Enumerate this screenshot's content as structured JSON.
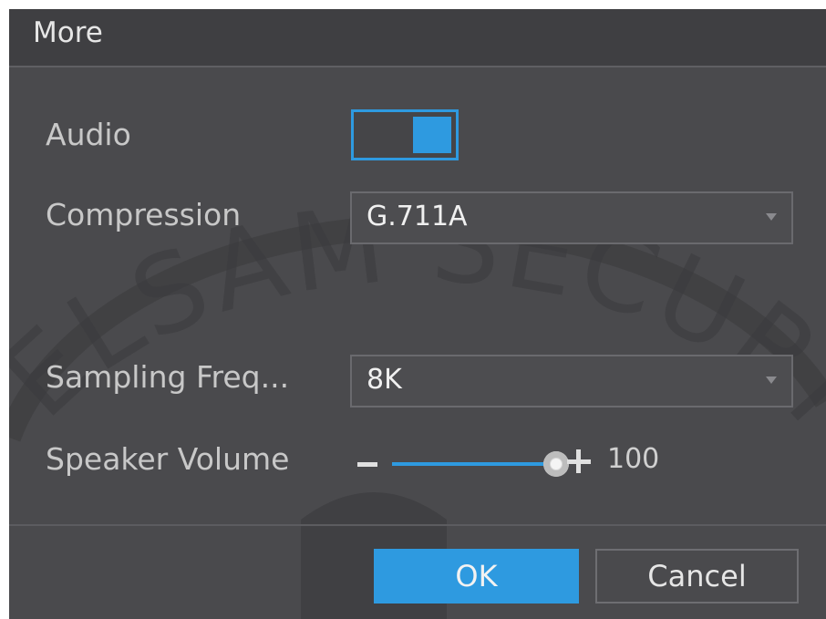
{
  "dialog": {
    "title": "More"
  },
  "form": {
    "audio": {
      "label": "Audio",
      "enabled": true
    },
    "compression": {
      "label": "Compression",
      "value": "G.711A"
    },
    "sampling": {
      "label": "Sampling Freq...",
      "value": "8K"
    },
    "speaker_volume": {
      "label": "Speaker Volume",
      "value": "100",
      "level_percent": 100
    }
  },
  "buttons": {
    "ok_label": "OK",
    "cancel_label": "Cancel"
  },
  "watermark": {
    "text": "ELSAM SECURITY"
  },
  "colors": {
    "accent": "#2e9ae0",
    "background": "#4a4a4d",
    "title_bar": "#3f3f42"
  }
}
